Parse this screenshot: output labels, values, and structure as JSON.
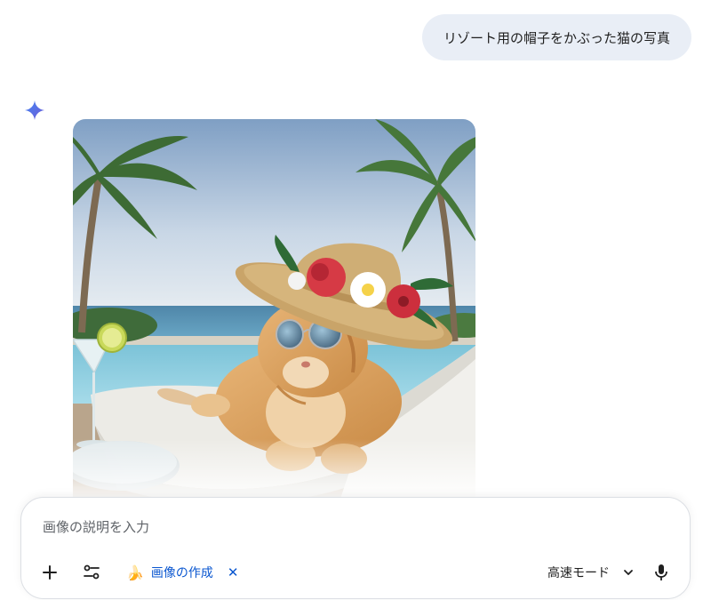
{
  "conversation": {
    "user_prompt": "リゾート用の帽子をかぶった猫の写真"
  },
  "response": {
    "icon": "gemini-sparkle-icon",
    "image_subject": "cat-in-resort-hat-image"
  },
  "input": {
    "placeholder": "画像の説明を入力",
    "add_icon": "plus-icon",
    "tools_icon": "tools-sliders-icon",
    "chip": {
      "emoji": "🍌",
      "label": "画像の作成",
      "close_symbol": "✕"
    },
    "mode": {
      "label": "高速モード",
      "chevron_icon": "chevron-down-icon"
    },
    "mic_icon": "microphone-icon"
  },
  "colors": {
    "accent": "#0b57d0",
    "bubble": "#e9eef6",
    "text": "#1f1f1f"
  }
}
